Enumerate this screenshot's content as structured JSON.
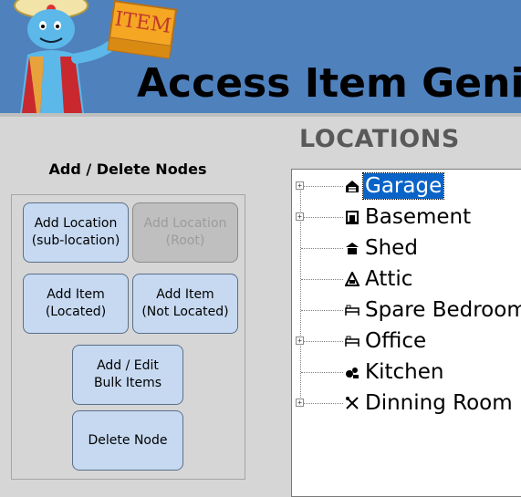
{
  "header": {
    "app_title": "Access Item Genie",
    "logo_text": "ITEM"
  },
  "nodes_panel": {
    "heading": "Add / Delete Nodes",
    "buttons": {
      "add_location_sub": "Add Location\n(sub-location)",
      "add_location_root": "Add Location\n(Root)",
      "add_item_located": "Add Item\n(Located)",
      "add_item_not_located": "Add Item\n(Not Located)",
      "add_edit_bulk": "Add / Edit\nBulk Items",
      "delete_node": "Delete Node"
    }
  },
  "locations": {
    "heading": "LOCATIONS",
    "nodes": [
      {
        "label": "Garage",
        "icon": "garage-icon",
        "expandable": true,
        "selected": true
      },
      {
        "label": "Basement",
        "icon": "basement-icon",
        "expandable": true,
        "selected": false
      },
      {
        "label": "Shed",
        "icon": "shed-icon",
        "expandable": false,
        "selected": false
      },
      {
        "label": "Attic",
        "icon": "attic-icon",
        "expandable": false,
        "selected": false
      },
      {
        "label": "Spare Bedroom",
        "icon": "bed-icon",
        "expandable": false,
        "selected": false
      },
      {
        "label": "Office",
        "icon": "bed-icon",
        "expandable": true,
        "selected": false
      },
      {
        "label": "Kitchen",
        "icon": "kitchen-icon",
        "expandable": false,
        "selected": false
      },
      {
        "label": "Dinning Room",
        "icon": "utensils-icon",
        "expandable": true,
        "selected": false
      }
    ]
  },
  "colors": {
    "banner": "#4f81bd",
    "button_fill": "#c6d9f1",
    "selection": "#0a64c8"
  }
}
